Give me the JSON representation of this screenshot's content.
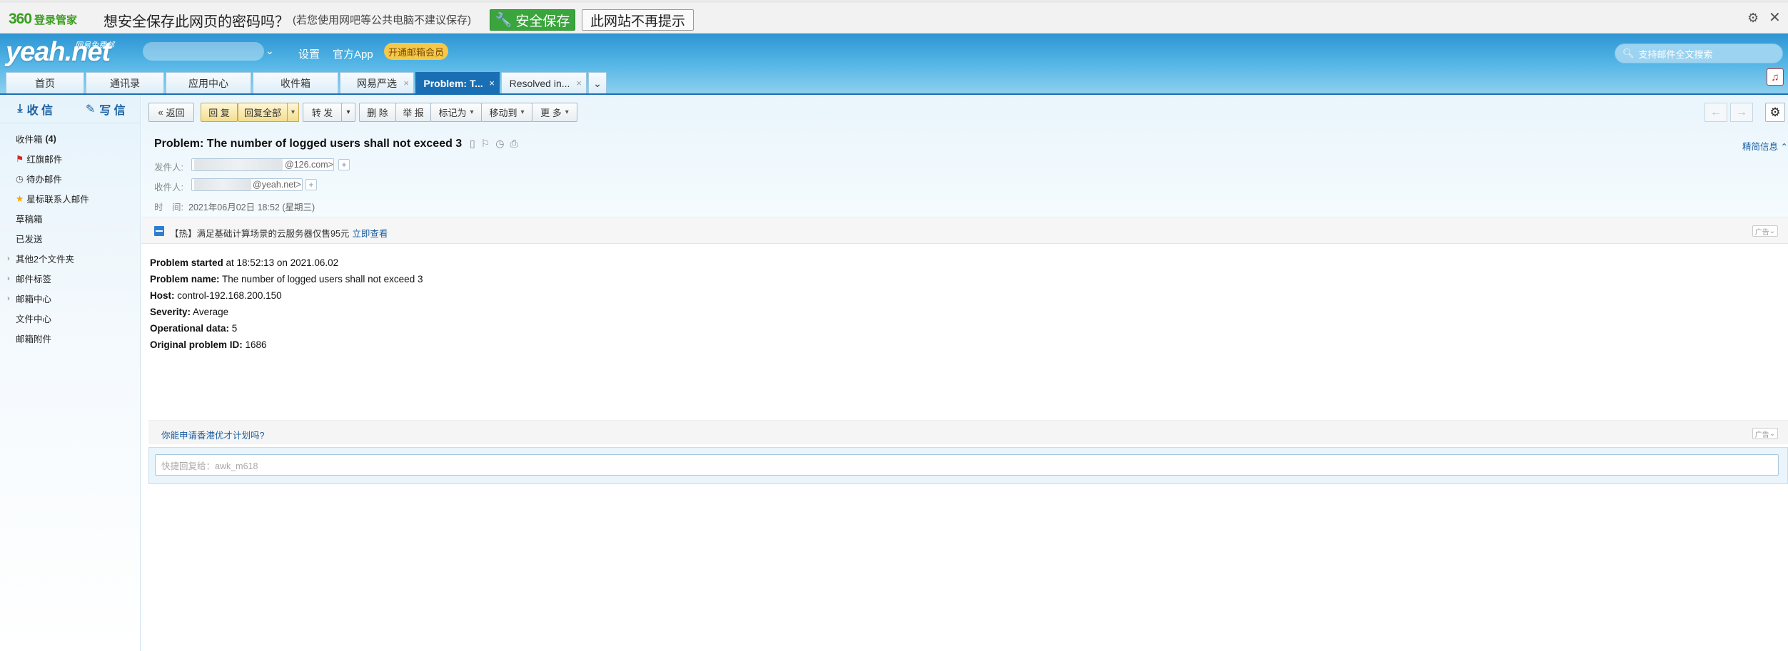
{
  "password_bar": {
    "logo": "360",
    "logo_sub": "登录管家",
    "question": "想安全保存此网页的密码吗？",
    "note": "(若您使用网吧等公共电脑不建议保存)",
    "save_label": "安全保存",
    "never_label": "此网站不再提示"
  },
  "header": {
    "brand": "yeah.net",
    "brand_sub": "网易免费邮",
    "links": [
      "设置",
      "官方App"
    ],
    "vip_label": "开通邮箱会员",
    "search_placeholder": "支持邮件全文搜索"
  },
  "tabs": [
    {
      "label": "首页",
      "closable": false,
      "active": false
    },
    {
      "label": "通讯录",
      "closable": false,
      "active": false
    },
    {
      "label": "应用中心",
      "closable": false,
      "active": false
    },
    {
      "label": "收件箱",
      "closable": false,
      "active": false
    },
    {
      "label": "网易严选",
      "closable": true,
      "active": false
    },
    {
      "label": "Problem: T...",
      "closable": true,
      "active": true
    },
    {
      "label": "Resolved in...",
      "closable": true,
      "active": false
    }
  ],
  "sidebar": {
    "receive_label": "收 信",
    "write_label": "写 信",
    "folders": [
      {
        "label": "收件箱",
        "count": "(4)",
        "icon": ""
      },
      {
        "label": "红旗邮件",
        "icon": "red-flag-icon"
      },
      {
        "label": "待办邮件",
        "icon": "clock-icon"
      },
      {
        "label": "星标联系人邮件",
        "icon": "star-icon"
      },
      {
        "label": "草稿箱",
        "icon": ""
      },
      {
        "label": "已发送",
        "icon": ""
      },
      {
        "label": "其他2个文件夹",
        "icon": "",
        "expandable": true
      },
      {
        "label": "邮件标签",
        "icon": "",
        "expandable": true
      },
      {
        "label": "邮箱中心",
        "icon": "",
        "expandable": true
      },
      {
        "label": "文件中心",
        "icon": ""
      },
      {
        "label": "邮箱附件",
        "icon": ""
      }
    ]
  },
  "toolbar": {
    "back": "返回",
    "reply": "回 复",
    "reply_all": "回复全部",
    "forward": "转 发",
    "delete": "删 除",
    "report": "举 报",
    "mark_as": "标记为",
    "move_to": "移动到",
    "more": "更 多"
  },
  "email": {
    "subject": "Problem: The number of logged users shall not exceed 3",
    "from_label": "发件人:",
    "from_suffix": "@126.com>",
    "to_label": "收件人:",
    "to_suffix": "@yeah.net>",
    "time_label": "时　间:",
    "time_value": "2021年06月02日 18:52 (星期三)",
    "brief_label": "精简信息"
  },
  "ad": {
    "text": "【热】满足基础计算场景的云服务器仅售95元",
    "link": "立即查看",
    "tag": "广告"
  },
  "body": [
    {
      "key": "Problem started",
      "value": " at 18:52:13 on 2021.06.02"
    },
    {
      "key": "Problem name:",
      "value": " The number of logged users shall not exceed 3"
    },
    {
      "key": "Host:",
      "value": " control-192.168.200.150"
    },
    {
      "key": "Severity:",
      "value": " Average"
    },
    {
      "key": "Operational data:",
      "value": " 5"
    },
    {
      "key": "Original problem ID:",
      "value": " 1686"
    }
  ],
  "promo": {
    "link": "你能申请香港优才计划吗?",
    "tag": "广告"
  },
  "quick_reply": {
    "placeholder": "快捷回复给：awk_m618"
  }
}
